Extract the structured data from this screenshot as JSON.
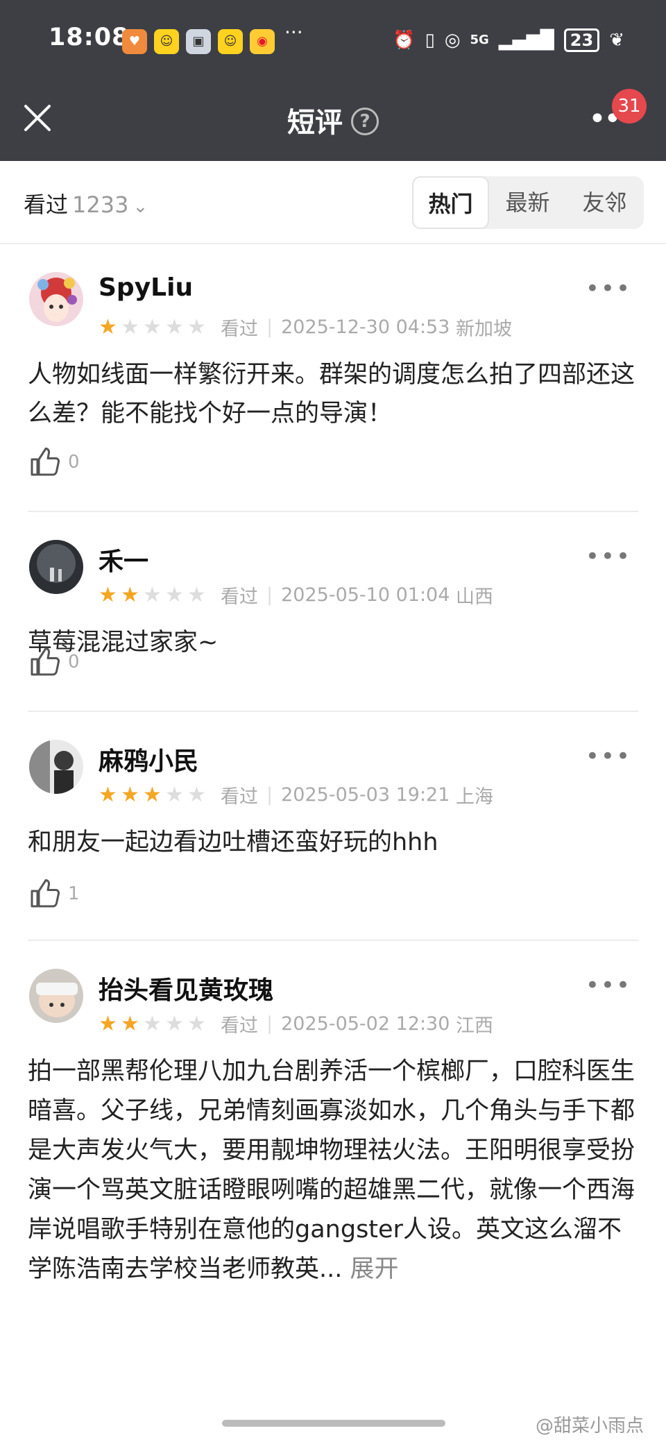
{
  "status_bar": {
    "time": "18:08",
    "dots": "···",
    "network": "5G",
    "battery": "23"
  },
  "nav": {
    "title": "短评",
    "help": "?",
    "badge": "31"
  },
  "filter": {
    "label": "看过",
    "count": "1233",
    "chevron": "⌄",
    "tabs": [
      "热门",
      "最新",
      "友邻"
    ],
    "active_tab": "热门"
  },
  "reviews": [
    {
      "user": "SpyLiu",
      "rating": 1,
      "status": "看过",
      "datetime": "2025-12-30 04:53",
      "location": "新加坡",
      "text": "人物如线面一样繁衍开来。群架的调度怎么拍了四部还这么差？能不能找个好一点的导演！",
      "likes": "0"
    },
    {
      "user": "禾一",
      "rating": 2,
      "status": "看过",
      "datetime": "2025-05-10 01:04",
      "location": "山西",
      "text": "草莓混混过家家~",
      "likes": "0"
    },
    {
      "user": "麻鸦小民",
      "rating": 3,
      "status": "看过",
      "datetime": "2025-05-03 19:21",
      "location": "上海",
      "text": "和朋友一起边看边吐槽还蛮好玩的hhh",
      "likes": "1"
    },
    {
      "user": "抬头看见黄玫瑰",
      "rating": 2,
      "status": "看过",
      "datetime": "2025-05-02 12:30",
      "location": "江西",
      "text": "拍一部黑帮伦理八加九台剧养活一个槟榔厂，口腔科医生暗喜。父子线，兄弟情刻画寡淡如水，几个角头与手下都是大声发火气大，要用靓坤物理祛火法。王阳明很享受扮演一个骂英文脏话瞪眼咧嘴的超雄黑二代，就像一个西海岸说唱歌手特别在意他的gangster人设。英文这么溜不学陈浩南去学校当老师教英...",
      "expand": "展开"
    }
  ],
  "watermark": "@甜菜小雨点",
  "colors": {
    "header_bg": "#3d3f44",
    "star": "#f5a623",
    "badge": "#e5484d"
  }
}
